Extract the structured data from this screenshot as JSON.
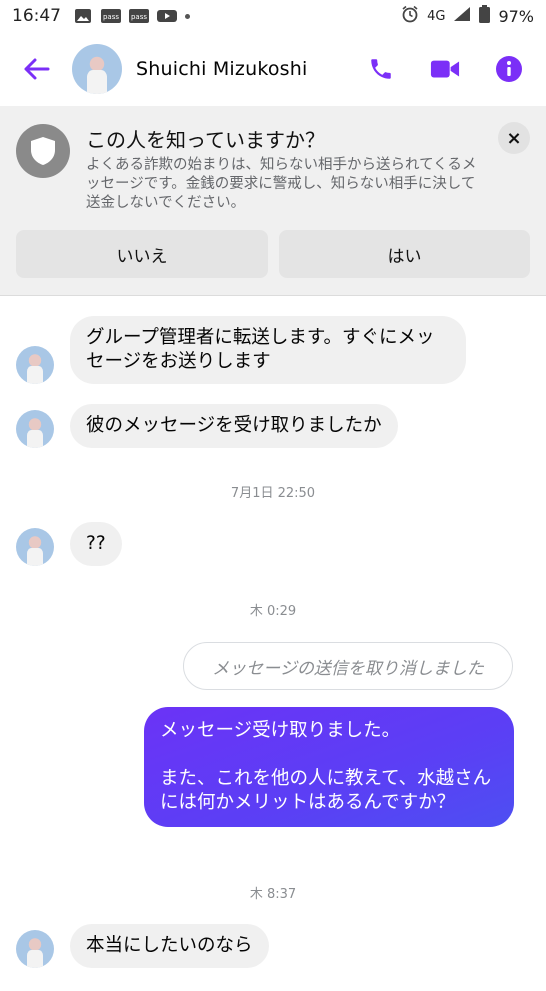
{
  "status_bar": {
    "time": "16:47",
    "notification_icons": [
      "image-icon",
      "pass-icon",
      "pass-icon",
      "youtube-icon"
    ],
    "network": "4G",
    "battery": "97%"
  },
  "header": {
    "contact_name": "Shuichi  Mizukoshi",
    "accent_color": "#7b2ff7"
  },
  "safety_banner": {
    "title": "この人を知っていますか？",
    "body": "よくある詐欺の始まりは、知らない相手から送られてくるメッセージです。金銭の要求に警戒し、知らない相手に決して送金しないでください。",
    "no_label": "いいえ",
    "yes_label": "はい",
    "close_label": "×"
  },
  "messages": [
    {
      "direction": "in",
      "text": "グループ管理者に転送します。すぐにメッセージをお送りします"
    },
    {
      "direction": "in",
      "text": "彼のメッセージを受け取りましたか"
    },
    {
      "timestamp": "7月1日 22:50"
    },
    {
      "direction": "in",
      "text": "??"
    },
    {
      "timestamp": "木 0:29"
    },
    {
      "unsent": "メッセージの送信を取り消しました"
    },
    {
      "direction": "out",
      "text": "メッセージ受け取りました。\n\nまた、これを他の人に教えて、水越さんには何かメリットはあるんですか？"
    },
    {
      "timestamp": "木 8:37"
    },
    {
      "direction": "in",
      "text": "本当にしたいのなら"
    }
  ]
}
